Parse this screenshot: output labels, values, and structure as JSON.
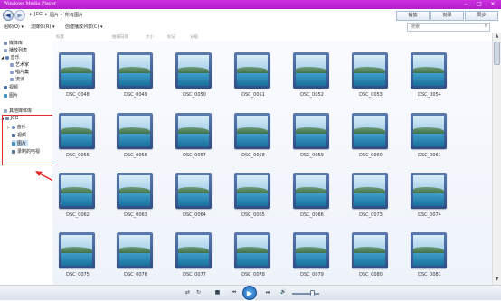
{
  "window": {
    "title": "Windows Media Player",
    "minimize_glyph": "–",
    "maximize_glyph": "□",
    "close_glyph": "✕"
  },
  "nav": {
    "back_glyph": "◀",
    "forward_glyph": "▶",
    "breadcrumb": [
      "JCG",
      "图片",
      "所有图片"
    ],
    "separator": "▸",
    "tabs": [
      "播放",
      "刻录",
      "同步"
    ]
  },
  "toolbar": {
    "organize": "组织(O) ▾",
    "stream": "流媒体(R) ▾",
    "create_playlist": "创建播放列表(C) ▾",
    "search_placeholder": "搜索"
  },
  "columns": [
    "标题",
    "拍摄日期",
    "大小",
    "标记",
    "分级"
  ],
  "sidebar": {
    "library": "媒体库",
    "playlists": "播放列表",
    "music": "音乐",
    "artist": "艺术家",
    "album": "唱片集",
    "genre": "流派",
    "videos": "视频",
    "pictures": "图片",
    "other_libraries": "其他媒体库",
    "jcg": "JCG",
    "jcg_music": "音乐",
    "jcg_videos": "视频",
    "jcg_pictures": "图片",
    "jcg_recorded_tv": "录制的电视"
  },
  "photos": [
    "DSC_0048",
    "DSC_0049",
    "DSC_0050",
    "DSC_0051",
    "DSC_0052",
    "DSC_0053",
    "DSC_0054",
    "DSC_0055",
    "DSC_0056",
    "DSC_0057",
    "DSC_0058",
    "DSC_0059",
    "DSC_0060",
    "DSC_0061",
    "DSC_0062",
    "DSC_0063",
    "DSC_0064",
    "DSC_0065",
    "DSC_0066",
    "DSC_0073",
    "DSC_0074",
    "DSC_0075",
    "DSC_0076",
    "DSC_0077",
    "DSC_0078",
    "DSC_0079",
    "DSC_0080",
    "DSC_0081"
  ],
  "player": {
    "shuffle_glyph": "⇄",
    "repeat_glyph": "↻",
    "stop_glyph": "■",
    "prev_glyph": "⏮",
    "play_glyph": "▶",
    "next_glyph": "⏭",
    "volume_glyph": "🔊"
  },
  "colors": {
    "titlebar": "#c02ad6",
    "annotation": "#e8282b",
    "play_button": "#1d5fb4"
  }
}
